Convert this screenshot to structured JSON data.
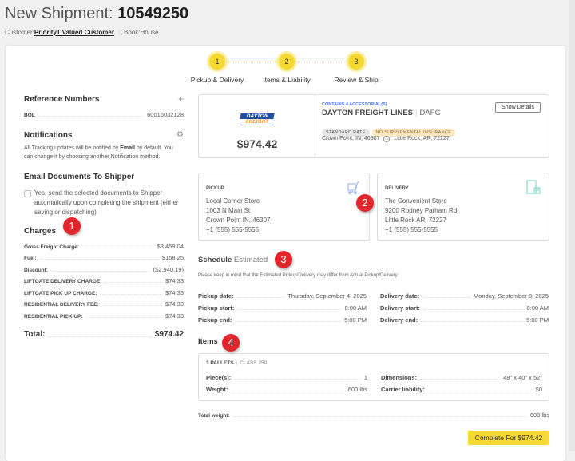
{
  "header": {
    "title_prefix": "New Shipment:",
    "shipment_number": "10549250",
    "customer_label": "Customer:",
    "customer": "Priority1 Valued Customer",
    "book_label": "Book:",
    "book": "House"
  },
  "stepper": [
    {
      "num": "1",
      "label": "Pickup & Delivery"
    },
    {
      "num": "2",
      "label": "Items & Liability"
    },
    {
      "num": "3",
      "label": "Review & Ship"
    }
  ],
  "reference": {
    "title": "Reference Numbers",
    "add_icon": "+",
    "rows": [
      {
        "k": "BOL",
        "v": "60016032128"
      }
    ]
  },
  "notifications": {
    "title": "Notifications",
    "text_pre": "All Tracking updates will be notified by ",
    "method": "Email",
    "text_post": " by default. You can change it by choosing another Notification method."
  },
  "email_docs": {
    "title": "Email Documents To Shipper",
    "checkbox_label": "Yes, send the selected documents to Shipper automatically upon completing the shipment (either saving or dispatching)",
    "checked": false
  },
  "charges": {
    "title": "Charges",
    "rows": [
      {
        "k": "Gross Freight Charge:",
        "v": "$3,459.04"
      },
      {
        "k": "Fuel:",
        "v": "$158.25"
      },
      {
        "k": "Discount:",
        "v": "($2,940.19)"
      },
      {
        "k": "LIFTGATE DELIVERY CHARGE:",
        "v": "$74.33"
      },
      {
        "k": "LIFTGATE PICK UP CHARGE:",
        "v": "$74.33"
      },
      {
        "k": "RESIDENTIAL DELIVERY FEE:",
        "v": "$74.33"
      },
      {
        "k": "RESIDENTIAL PICK UP:",
        "v": "$74.33"
      }
    ],
    "total_label": "Total:",
    "total": "$974.42"
  },
  "carrier": {
    "logo_line1": "DAYTON",
    "logo_line2": "FREIGHT",
    "price": "$974.42",
    "accessorials": "CONTAINS 4 ACCESSORIAL(S)",
    "name": "DAYTON FREIGHT LINES",
    "scac": "DAFG",
    "pills": [
      "STANDARD RATE",
      "NO SUPPLEMENTAL INSURANCE"
    ],
    "origin": "Crown Point, IN, 46307",
    "destination": "Little Rock, AR, 72227",
    "show_details": "Show Details"
  },
  "pickup": {
    "title": "PICKUP",
    "lines": [
      "Local Corner Store",
      "1003 N Main St",
      "Crown Point IN, 46307",
      "+1 (555) 555-5555"
    ]
  },
  "delivery": {
    "title": "DELIVERY",
    "lines": [
      "The Convenient Store",
      "9200 Rodney Parham Rd",
      "Little Rock AR, 72227",
      "+1 (555) 555-5555"
    ]
  },
  "schedule": {
    "title": "Schedule",
    "subtitle": "Estimated",
    "note": "Please keep in mind that the Estimated Pickup/Delivery may differ from Actual Pickup/Delivery.",
    "pickup": [
      {
        "k": "Pickup date:",
        "v": "Thursday, September 4, 2025"
      },
      {
        "k": "Pickup start:",
        "v": "8:00 AM"
      },
      {
        "k": "Pickup end:",
        "v": "5:00 PM"
      }
    ],
    "delivery": [
      {
        "k": "Delivery date:",
        "v": "Monday, September 8, 2025"
      },
      {
        "k": "Delivery start:",
        "v": "8:00 AM"
      },
      {
        "k": "Delivery end:",
        "v": "5:00 PM"
      }
    ]
  },
  "items": {
    "title": "Items",
    "head": "3 PALLETS",
    "class": "CLASS 250",
    "left": [
      {
        "k": "Piece(s):",
        "v": "1"
      },
      {
        "k": "Weight:",
        "v": "600 lbs"
      }
    ],
    "right": [
      {
        "k": "Dimensions:",
        "v": "48\" x 40\" x 52\""
      },
      {
        "k": "Carrier liability:",
        "v": "$0"
      }
    ],
    "total_weight_label": "Total weight:",
    "total_weight": "600 lbs"
  },
  "complete_button": "Complete For $974.42",
  "callouts": [
    "1",
    "2",
    "3",
    "4"
  ]
}
